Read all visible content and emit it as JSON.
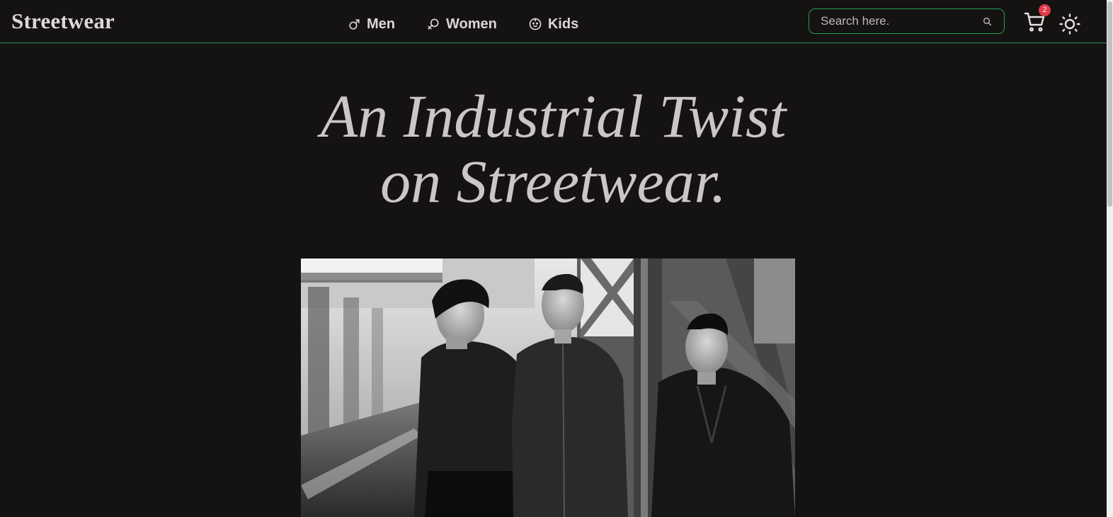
{
  "header": {
    "logo": "Streetwear",
    "nav": [
      {
        "label": "Men",
        "icon": "male-symbol-icon"
      },
      {
        "label": "Women",
        "icon": "female-symbol-icon"
      },
      {
        "label": "Kids",
        "icon": "baby-face-icon"
      }
    ],
    "search": {
      "placeholder": "Search here.",
      "value": ""
    },
    "cart": {
      "count": "2",
      "icon": "shopping-cart-icon"
    },
    "theme_icon": "sun-icon"
  },
  "hero": {
    "title_line1": "An Industrial Twist",
    "title_line2": "on Streetwear.",
    "image_alt": "Three men in black clothing on an industrial steel bridge"
  },
  "colors": {
    "background": "#151212",
    "accent": "#1fa04f",
    "badge": "#e13a48",
    "text": "#dcd7d7"
  }
}
